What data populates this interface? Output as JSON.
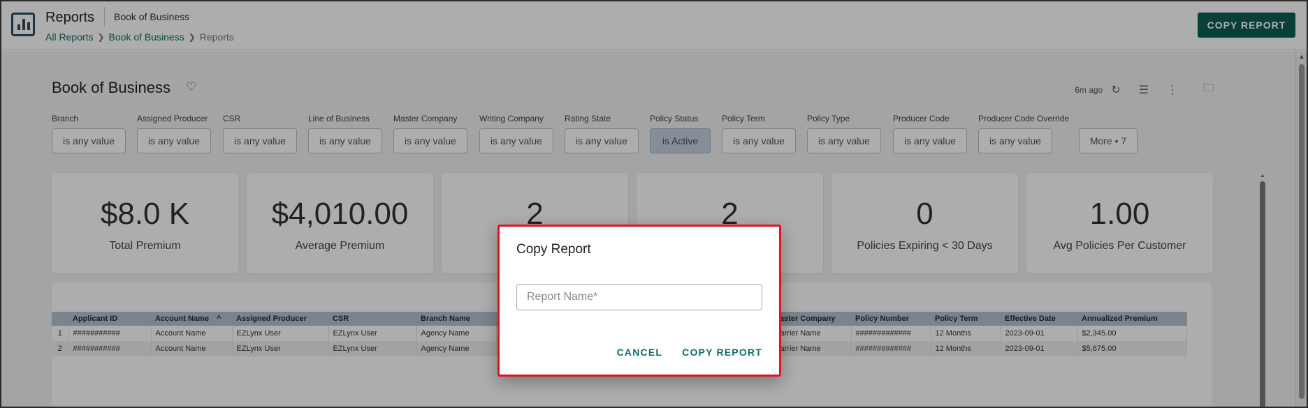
{
  "header": {
    "title": "Reports",
    "subtitle": "Book of Business",
    "breadcrumb": [
      "All Reports",
      "Book of Business",
      "Reports"
    ],
    "copy_button": "COPY REPORT"
  },
  "dashboard": {
    "title": "Book of Business",
    "updated": "6m ago"
  },
  "filters": [
    {
      "label": "Branch",
      "value": "is any value"
    },
    {
      "label": "Assigned Producer",
      "value": "is any value"
    },
    {
      "label": "CSR",
      "value": "is any value"
    },
    {
      "label": "Line of Business",
      "value": "is any value"
    },
    {
      "label": "Master Company",
      "value": "is any value"
    },
    {
      "label": "Writing Company",
      "value": "is any value"
    },
    {
      "label": "Rating State",
      "value": "is any value"
    },
    {
      "label": "Policy Status",
      "value": "is Active"
    },
    {
      "label": "Policy Term",
      "value": "is any value"
    },
    {
      "label": "Policy Type",
      "value": "is any value"
    },
    {
      "label": "Producer Code",
      "value": "is any value"
    },
    {
      "label": "Producer Code Override",
      "value": "is any value"
    }
  ],
  "more_filters": "More • 7",
  "kpis": [
    {
      "value": "$8.0 K",
      "caption": "Total Premium"
    },
    {
      "value": "$4,010.00",
      "caption": "Average Premium"
    },
    {
      "value": "2",
      "caption": ""
    },
    {
      "value": "2",
      "caption": ""
    },
    {
      "value": "0",
      "caption": "Policies Expiring < 30 Days"
    },
    {
      "value": "1.00",
      "caption": "Avg Policies Per Customer"
    }
  ],
  "table": {
    "columns": [
      "Applicant ID",
      "Account Name",
      "Assigned Producer",
      "CSR",
      "Branch Name",
      "",
      "",
      "aster Company",
      "Policy Number",
      "Policy Term",
      "Effective Date",
      "Annualized Premium"
    ],
    "sort_indicator": "^",
    "rows": [
      {
        "idx": "1",
        "cells": [
          "###########",
          "Account Name",
          "EZLynx User",
          "EZLynx User",
          "Agency Name",
          "",
          "",
          "arrier Name",
          "#############",
          "12 Months",
          "2023-09-01",
          "$2,345.00"
        ]
      },
      {
        "idx": "2",
        "cells": [
          "###########",
          "Account Name",
          "EZLynx User",
          "EZLynx User",
          "Agency Name",
          "",
          "",
          "arrier Name",
          "#############",
          "12 Months",
          "2023-09-01",
          "$5,675.00"
        ]
      }
    ]
  },
  "dialog": {
    "title": "Copy Report",
    "input_placeholder": "Report Name*",
    "input_value": "",
    "cancel": "CANCEL",
    "confirm": "COPY REPORT"
  },
  "colors": {
    "accent": "#0b5e55",
    "link": "#0b6e63",
    "highlight_border": "#e0141e",
    "active_chip": "#c5d2df"
  }
}
